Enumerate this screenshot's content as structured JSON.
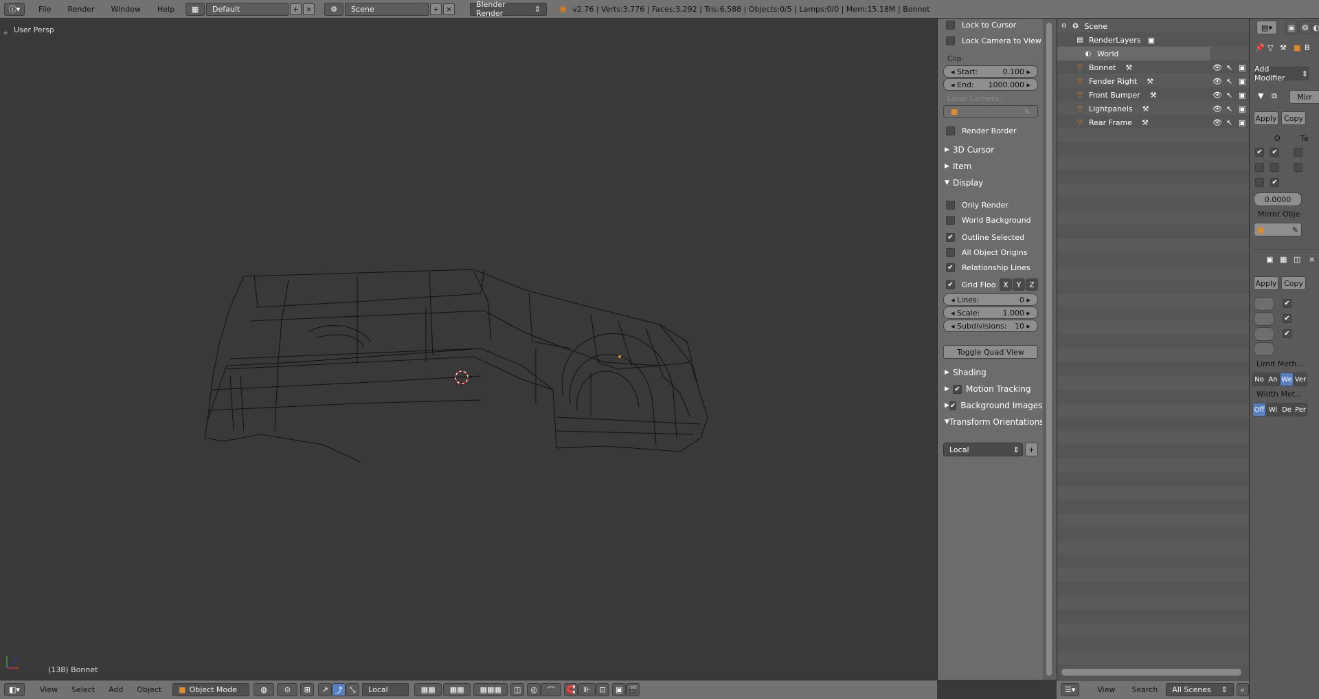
{
  "topbar": {
    "menus": [
      "File",
      "Render",
      "Window",
      "Help"
    ],
    "layout": "Default",
    "scene": "Scene",
    "engine": "Blender Render",
    "info": "v2.76 | Verts:3,776 | Faces:3,292 | Tris:6,588 | Objects:0/5 | Lamps:0/0 | Mem:15.18M | Bonnet"
  },
  "viewport": {
    "persp_label": "User Persp",
    "object_label": "(138) Bonnet"
  },
  "viewport_bar": {
    "menus": [
      "View",
      "Select",
      "Add",
      "Object"
    ],
    "mode": "Object Mode",
    "orientation": "Local"
  },
  "props": {
    "lock_cursor": "Lock to Cursor",
    "lock_camera": "Lock Camera to View",
    "clip_label": "Clip:",
    "clip_start_label": "Start:",
    "clip_start": "0.100",
    "clip_end_label": "End:",
    "clip_end": "1000.000",
    "local_camera": "Local Camera:",
    "render_border": "Render Border",
    "sec_cursor": "3D Cursor",
    "sec_item": "Item",
    "sec_display": "Display",
    "only_render": "Only Render",
    "world_bg": "World Background",
    "outline_sel": "Outline Selected",
    "all_origins": "All Object Origins",
    "rel_lines": "Relationship Lines",
    "grid_floor": "Grid Floo",
    "axis_x": "X",
    "axis_y": "Y",
    "axis_z": "Z",
    "lines_label": "Lines:",
    "lines": "0",
    "scale_label": "Scale:",
    "scale": "1.000",
    "subdiv_label": "Subdivisions:",
    "subdiv": "10",
    "toggle_quad": "Toggle Quad View",
    "sec_shading": "Shading",
    "sec_motion": "Motion Tracking",
    "sec_bgimages": "Background Images",
    "sec_transform": "Transform Orientations",
    "orient": "Local"
  },
  "outliner": {
    "items": [
      {
        "name": "Scene"
      },
      {
        "name": "RenderLayers"
      },
      {
        "name": "World"
      },
      {
        "name": "Bonnet"
      },
      {
        "name": "Fender Right"
      },
      {
        "name": "Front Bumper"
      },
      {
        "name": "Lightpanels"
      },
      {
        "name": "Rear Frame"
      }
    ],
    "bottom_view": "View",
    "bottom_search": "Search",
    "bottom_scenes": "All Scenes"
  },
  "modifiers": {
    "object": "B",
    "add_modifier": "Add Modifier",
    "mirror": "Mirr",
    "apply": "Apply",
    "copy": "Copy",
    "col_o": "O",
    "col_te": "Te",
    "merge": "0.0000",
    "mirror_obj": "Mirror Obje",
    "apply2": "Apply",
    "copy2": "Copy",
    "limit_method": "Limit Meth...",
    "limit_opts": [
      "No",
      "An",
      "We",
      "Ver"
    ],
    "width_method": "Width Met...",
    "width_opts": [
      "Off",
      "Wi",
      "De",
      "Per"
    ]
  },
  "colors": {
    "header": "#727272",
    "viewport": "#393939",
    "panel": "#6c6c6c",
    "accent": "#5680c2",
    "mesh_orange": "#e08a2a"
  }
}
